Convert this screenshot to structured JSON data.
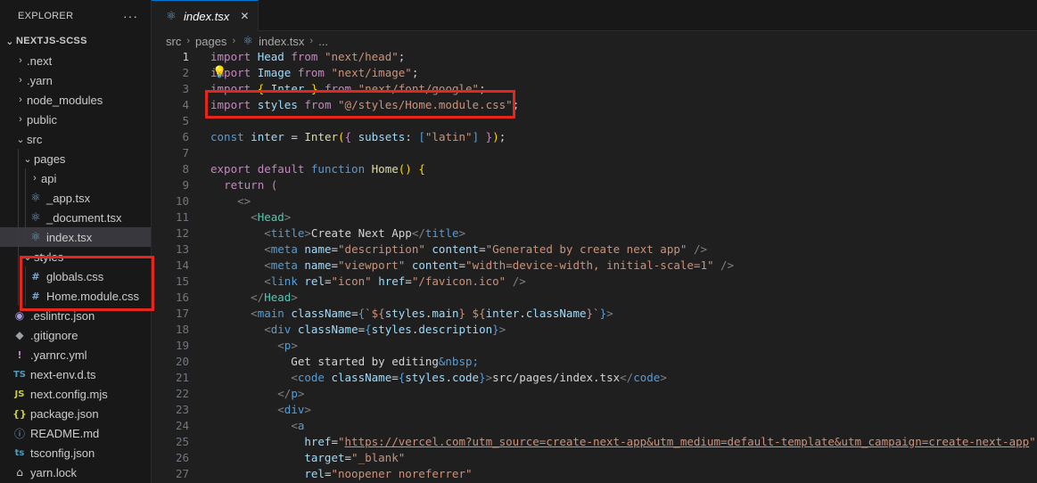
{
  "explorer": {
    "title": "EXPLORER",
    "more": "···",
    "root": "NEXTJS-SCSS",
    "items": [
      {
        "label": ".next",
        "icon": "chevron-right-icon"
      },
      {
        "label": ".yarn",
        "icon": "chevron-right-icon"
      },
      {
        "label": "node_modules",
        "icon": "chevron-right-icon"
      },
      {
        "label": "public",
        "icon": "chevron-right-icon"
      },
      {
        "label": "src",
        "icon": "chevron-down-icon"
      },
      {
        "label": "pages",
        "icon": "chevron-down-icon"
      },
      {
        "label": "api",
        "icon": "chevron-right-icon"
      },
      {
        "label": "_app.tsx",
        "icon": "react-icon"
      },
      {
        "label": "_document.tsx",
        "icon": "react-icon"
      },
      {
        "label": "index.tsx",
        "icon": "react-icon"
      },
      {
        "label": "styles",
        "icon": "chevron-down-icon"
      },
      {
        "label": "globals.css",
        "icon": "css-hash-icon"
      },
      {
        "label": "Home.module.css",
        "icon": "css-hash-icon"
      },
      {
        "label": ".eslintrc.json",
        "icon": "eslint-icon"
      },
      {
        "label": ".gitignore",
        "icon": "git-icon"
      },
      {
        "label": ".yarnrc.yml",
        "icon": "yaml-icon"
      },
      {
        "label": "next-env.d.ts",
        "icon": "typescript-icon"
      },
      {
        "label": "next.config.mjs",
        "icon": "javascript-icon"
      },
      {
        "label": "package.json",
        "icon": "json-icon"
      },
      {
        "label": "README.md",
        "icon": "info-icon"
      },
      {
        "label": "tsconfig.json",
        "icon": "typescript-config-icon"
      },
      {
        "label": "yarn.lock",
        "icon": "lock-icon"
      }
    ]
  },
  "tab": {
    "label": "index.tsx",
    "close": "✕"
  },
  "breadcrumb": {
    "parts": [
      "src",
      "pages",
      "index.tsx",
      "..."
    ]
  },
  "code": {
    "line_numbers": [
      "1",
      "2",
      "3",
      "4",
      "5",
      "6",
      "7",
      "8",
      "9",
      "10",
      "11",
      "12",
      "13",
      "14",
      "15",
      "16",
      "17",
      "18",
      "19",
      "20",
      "21",
      "22",
      "23",
      "24",
      "25",
      "26",
      "27"
    ],
    "active_line": "1"
  },
  "colors": {
    "highlight": "#e5261c",
    "accent": "#0078d4"
  }
}
